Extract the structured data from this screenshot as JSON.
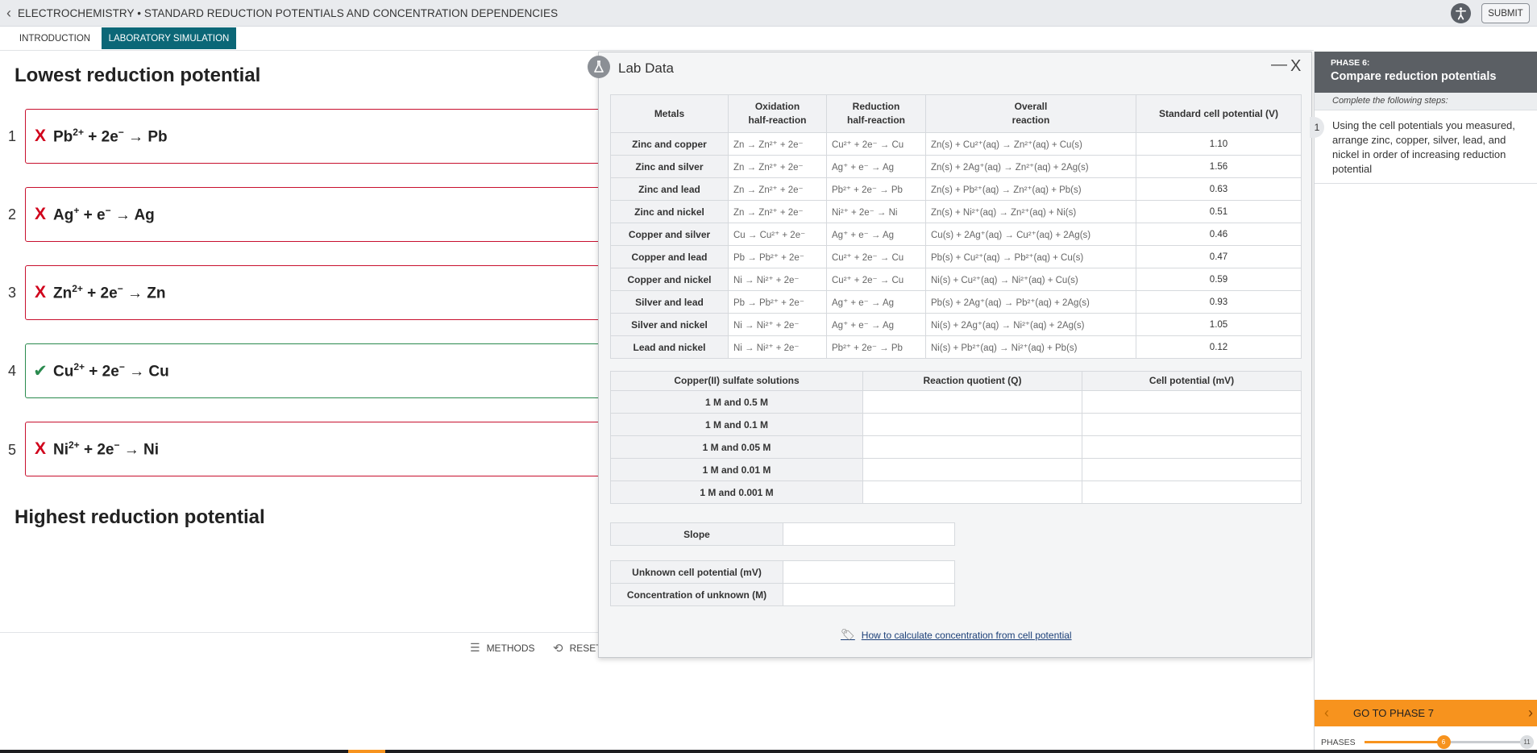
{
  "app": {
    "title": "ELECTROCHEMISTRY • STANDARD REDUCTION POTENTIALS AND CONCENTRATION DEPENDENCIES",
    "submit_label": "SUBMIT"
  },
  "tabs": [
    {
      "label": "INTRODUCTION",
      "active": false
    },
    {
      "label": "LABORATORY SIMULATION",
      "active": true
    }
  ],
  "left": {
    "top_heading": "Lowest reduction potential",
    "bottom_heading": "Highest reduction potential",
    "rows": [
      {
        "num": "1",
        "mark": "X",
        "status": "incorrect",
        "ion": "Pb",
        "charge": "2+",
        "rest": " + 2e",
        "electron_sup": "−",
        "product": " → Pb"
      },
      {
        "num": "2",
        "mark": "X",
        "status": "incorrect",
        "ion": "Ag",
        "charge": "+",
        "rest": " + e",
        "electron_sup": "−",
        "product": " → Ag"
      },
      {
        "num": "3",
        "mark": "X",
        "status": "incorrect",
        "ion": "Zn",
        "charge": "2+",
        "rest": " + 2e",
        "electron_sup": "−",
        "product": " → Zn"
      },
      {
        "num": "4",
        "mark": "✔",
        "status": "correct",
        "ion": "Cu",
        "charge": "2+",
        "rest": " + 2e",
        "electron_sup": "−",
        "product": " → Cu"
      },
      {
        "num": "5",
        "mark": "X",
        "status": "incorrect",
        "ion": "Ni",
        "charge": "2+",
        "rest": " + 2e",
        "electron_sup": "−",
        "product": " → Ni"
      }
    ],
    "footer": {
      "methods_label": "METHODS",
      "reset_label": "RESET"
    }
  },
  "modal": {
    "title": "Lab Data",
    "min_label": "—",
    "close_label": "X",
    "table1": {
      "headers": [
        "Metals",
        "Oxidation\nhalf-reaction",
        "Reduction\nhalf-reaction",
        "Overall\nreaction",
        "Standard cell potential (V)"
      ],
      "rows": [
        {
          "metals": "Zinc and copper",
          "ox": "Zn → Zn²⁺ + 2e⁻",
          "red": "Cu²⁺ + 2e⁻ → Cu",
          "overall": "Zn(s) + Cu²⁺(aq) → Zn²⁺(aq) + Cu(s)",
          "v": "1.10"
        },
        {
          "metals": "Zinc and silver",
          "ox": "Zn → Zn²⁺ + 2e⁻",
          "red": "Ag⁺ + e⁻ → Ag",
          "overall": "Zn(s) + 2Ag⁺(aq) → Zn²⁺(aq) + 2Ag(s)",
          "v": "1.56"
        },
        {
          "metals": "Zinc and lead",
          "ox": "Zn → Zn²⁺ + 2e⁻",
          "red": "Pb²⁺ + 2e⁻ → Pb",
          "overall": "Zn(s) + Pb²⁺(aq) → Zn²⁺(aq) + Pb(s)",
          "v": "0.63"
        },
        {
          "metals": "Zinc and nickel",
          "ox": "Zn → Zn²⁺ + 2e⁻",
          "red": "Ni²⁺ + 2e⁻ → Ni",
          "overall": "Zn(s) + Ni²⁺(aq) → Zn²⁺(aq) + Ni(s)",
          "v": "0.51"
        },
        {
          "metals": "Copper and silver",
          "ox": "Cu → Cu²⁺ + 2e⁻",
          "red": "Ag⁺ + e⁻ → Ag",
          "overall": "Cu(s) + 2Ag⁺(aq) → Cu²⁺(aq) + 2Ag(s)",
          "v": "0.46"
        },
        {
          "metals": "Copper and lead",
          "ox": "Pb → Pb²⁺ + 2e⁻",
          "red": "Cu²⁺ + 2e⁻ → Cu",
          "overall": "Pb(s) + Cu²⁺(aq) → Pb²⁺(aq) + Cu(s)",
          "v": "0.47"
        },
        {
          "metals": "Copper and nickel",
          "ox": "Ni → Ni²⁺ + 2e⁻",
          "red": "Cu²⁺ + 2e⁻ → Cu",
          "overall": "Ni(s) + Cu²⁺(aq) → Ni²⁺(aq) + Cu(s)",
          "v": "0.59"
        },
        {
          "metals": "Silver and lead",
          "ox": "Pb → Pb²⁺ + 2e⁻",
          "red": "Ag⁺ + e⁻ → Ag",
          "overall": "Pb(s) + 2Ag⁺(aq) → Pb²⁺(aq) + 2Ag(s)",
          "v": "0.93"
        },
        {
          "metals": "Silver and nickel",
          "ox": "Ni → Ni²⁺ + 2e⁻",
          "red": "Ag⁺ + e⁻ → Ag",
          "overall": "Ni(s) + 2Ag⁺(aq) → Ni²⁺(aq) + 2Ag(s)",
          "v": "1.05"
        },
        {
          "metals": "Lead and nickel",
          "ox": "Ni → Ni²⁺ + 2e⁻",
          "red": "Pb²⁺ + 2e⁻ → Pb",
          "overall": "Ni(s) + Pb²⁺(aq) → Ni²⁺(aq) + Pb(s)",
          "v": "0.12"
        }
      ]
    },
    "table2": {
      "headers": [
        "Copper(II) sulfate solutions",
        "Reaction quotient (Q)",
        "Cell potential (mV)"
      ],
      "rows": [
        "1 M and 0.5 M",
        "1 M and 0.1 M",
        "1 M and 0.05 M",
        "1 M and 0.01 M",
        "1 M and 0.001 M"
      ]
    },
    "slope_label": "Slope",
    "unknown_potential_label": "Unknown cell potential (mV)",
    "unknown_conc_label": "Concentration of unknown (M)",
    "howto_link": "How to calculate concentration from cell potential"
  },
  "sidebar": {
    "phase_label": "PHASE 6:",
    "phase_title": "Compare reduction potentials",
    "steps_header": "Complete the following steps:",
    "step_num": "1",
    "step_text": "Using the cell potentials you measured, arrange zinc, copper, silver, lead, and nickel in order of increasing reduction potential",
    "goto_label": "GO TO PHASE 7",
    "phases_label": "PHASES",
    "current_phase": "6",
    "total_phases": "11",
    "progress": 0.5
  }
}
